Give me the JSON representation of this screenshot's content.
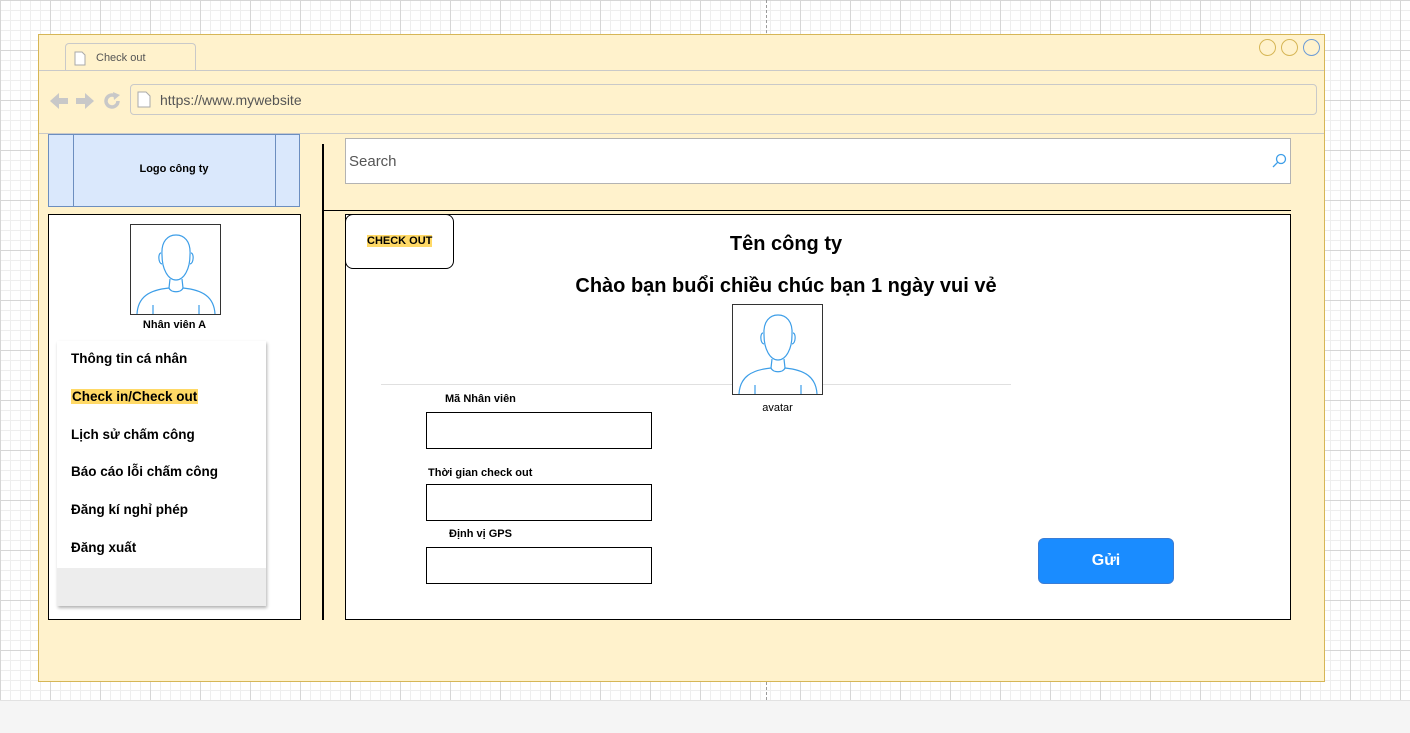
{
  "browser": {
    "tab_title": "Check out",
    "url": "https://www.mywebsite"
  },
  "header": {
    "logo_text": "Logo công ty",
    "search_placeholder": "Search"
  },
  "sidebar": {
    "user_name": "Nhân viên A",
    "menu": [
      {
        "label": "Thông tin cá nhân",
        "active": false
      },
      {
        "label": "Check in/Check out",
        "active": true
      },
      {
        "label": "Lịch sử chấm công",
        "active": false
      },
      {
        "label": "Báo cáo lỗi chấm công",
        "active": false
      },
      {
        "label": "Đăng kí nghỉ phép",
        "active": false
      },
      {
        "label": "Đăng xuất",
        "active": false
      }
    ]
  },
  "main": {
    "checkout_label": "CHECK OUT",
    "company_name": "Tên công ty",
    "greeting": "Chào bạn buổi chiều chúc bạn 1 ngày vui vẻ",
    "avatar_label": "avatar",
    "fields": {
      "employee_id_label": "Mã Nhân viên",
      "employee_id_value": "",
      "checkout_time_label": "Thời gian check out",
      "checkout_time_value": "",
      "gps_label": "Định vị GPS",
      "gps_value": ""
    },
    "submit_label": "Gửi"
  },
  "colors": {
    "window_bg": "#fff2cc",
    "logo_bg": "#dae8fc",
    "highlight": "#ffd966",
    "submit_bg": "#1a8cff",
    "icon_stroke": "#3d9ee8"
  }
}
